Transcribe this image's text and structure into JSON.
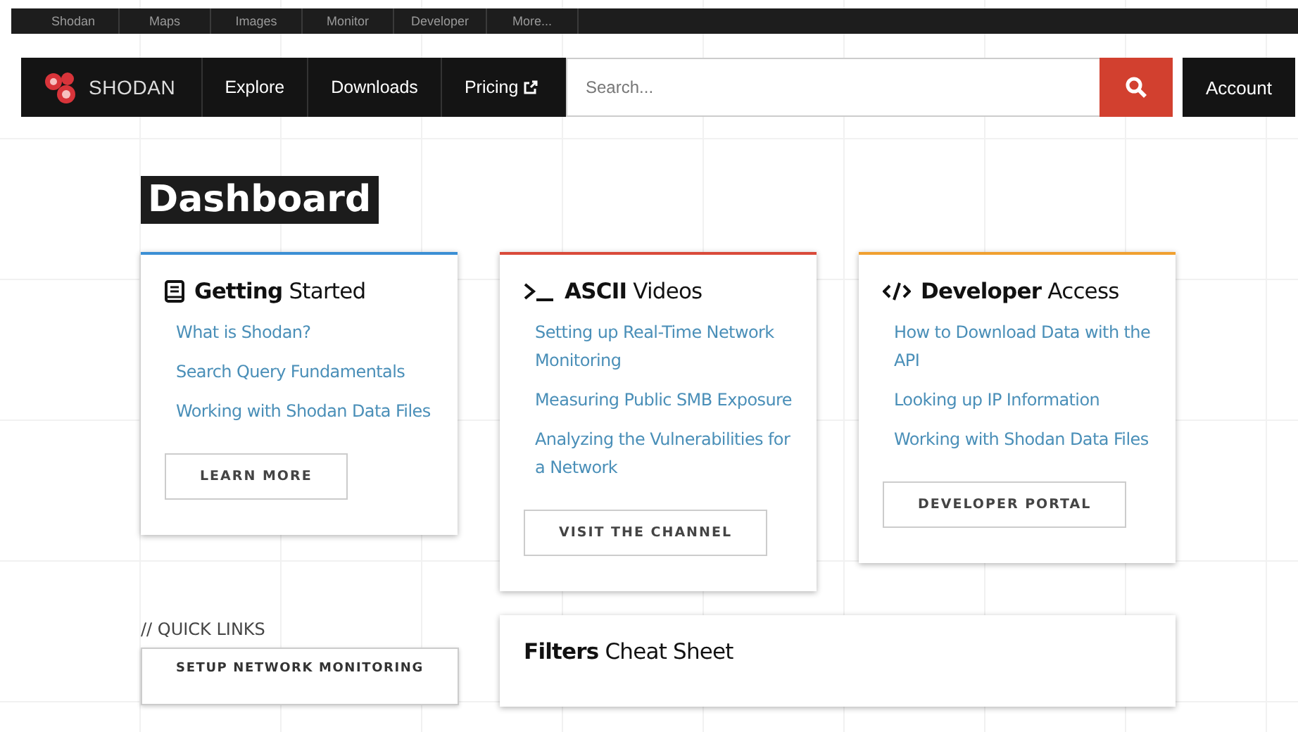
{
  "top_bar": {
    "items": [
      "Shodan",
      "Maps",
      "Images",
      "Monitor",
      "Developer",
      "More..."
    ]
  },
  "nav": {
    "brand": "SHODAN",
    "links": [
      {
        "label": "Explore",
        "external": false
      },
      {
        "label": "Downloads",
        "external": false
      },
      {
        "label": "Pricing",
        "external": true
      }
    ],
    "search": {
      "placeholder": "Search..."
    },
    "account": "Account"
  },
  "page_title": "Dashboard",
  "cards": [
    {
      "kind": "book",
      "color": "#3b8fd4",
      "title": "**Getting** Started",
      "links": [
        "What is Shodan?",
        "Search Query Fundamentals",
        "Working with Shodan Data Files"
      ],
      "button": "LEARN MORE"
    },
    {
      "kind": "terminal",
      "color": "#d94a3a",
      "title": "**ASCII** Videos",
      "links": [
        "Setting up Real-Time Network Monitoring",
        "Measuring Public SMB Exposure",
        "Analyzing the Vulnerabilities for a Network"
      ],
      "button": "VISIT THE CHANNEL"
    },
    {
      "kind": "code",
      "color": "#f0a030",
      "title": "**Developer** Access",
      "links": [
        "How to Download Data with the API",
        "Looking up IP Information",
        "Working with Shodan Data Files"
      ],
      "button": "DEVELOPER PORTAL"
    }
  ],
  "quick_links": {
    "label": "// QUICK LINKS",
    "buttons": [
      "SETUP NETWORK MONITORING"
    ]
  },
  "filters_card": {
    "title": "**Filters** Cheat Sheet"
  }
}
